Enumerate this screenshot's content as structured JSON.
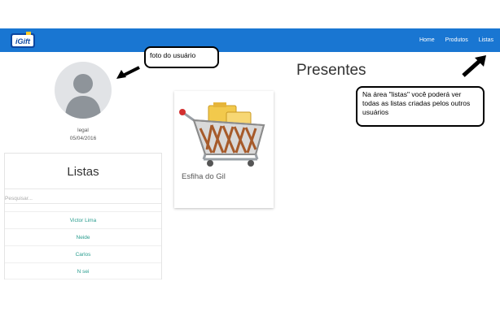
{
  "navbar": {
    "logo_alt": "iGift",
    "links": [
      "Home",
      "Produtos",
      "Listas"
    ],
    "color": "#1976d2"
  },
  "profile": {
    "username": "legal",
    "date": "05/04/2016"
  },
  "lists_panel": {
    "title": "Listas",
    "search_placeholder": "Pesquisar...",
    "items": [
      "Victor Lima",
      "Neide",
      "Carlos",
      "N sei"
    ]
  },
  "main": {
    "title": "Presentes",
    "products": [
      {
        "name": "Esfiha do Gil",
        "icon": "shopping-cart-icon"
      }
    ]
  },
  "annotations": {
    "photo_note": "foto do usuário",
    "lists_note": "Na área \"listas\" você poderá ver todas as listas criadas pelos outros usuários"
  }
}
